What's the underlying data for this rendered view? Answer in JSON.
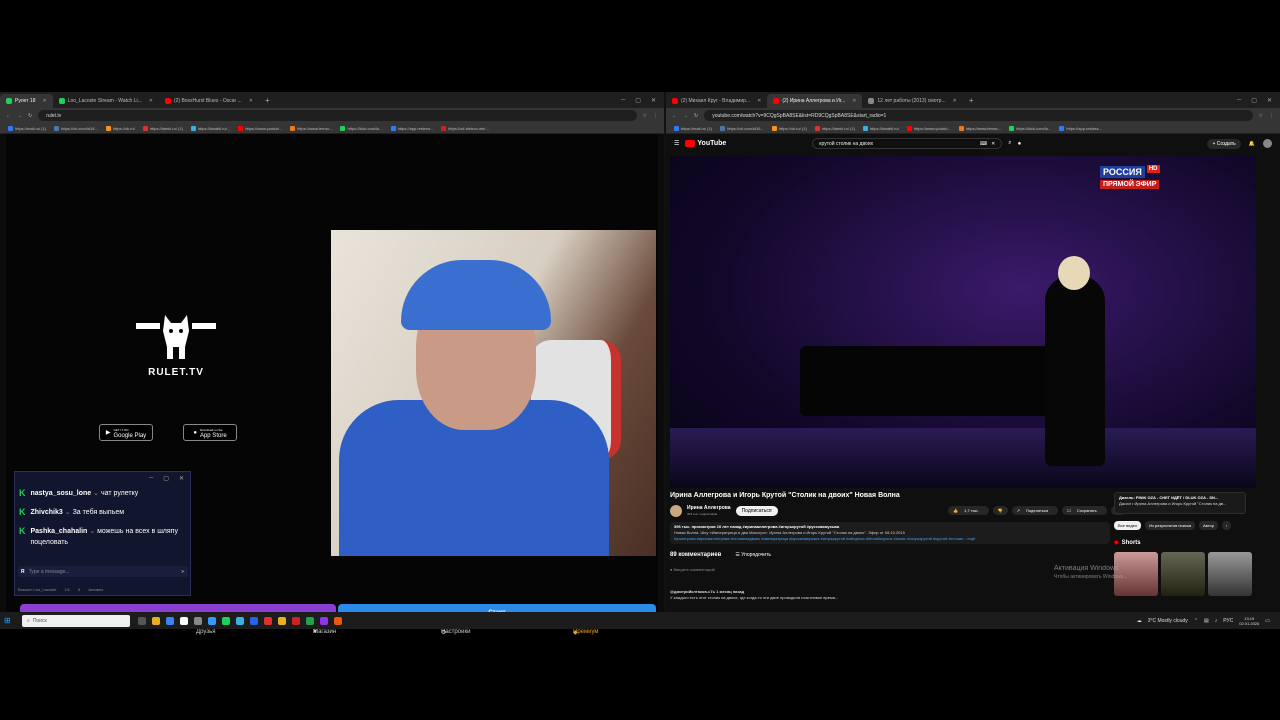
{
  "left_window": {
    "tabs": [
      {
        "label": "Рулет 18",
        "color": "#1fd15a",
        "active": true
      },
      {
        "label": "Loo_Lacoste Stream - Watch Li...",
        "color": "#1fd15a",
        "active": false
      },
      {
        "label": "(2) BossHurst Blues - Oscar ...",
        "color": "#ff0000",
        "active": false
      }
    ],
    "url": "rulet.tv",
    "bookmarks": [
      "https://mail.ru/ (1)",
      "https://vk.com/id16...",
      "https://ok.ru/",
      "https://lamki.ru/ (1)",
      "https://kwabli.ru/...",
      "https://www.youtub...",
      "https://www.terrao...",
      "https://kick.com/lo...",
      "https://app.restrea...",
      "https://zd.stetroo.me/..."
    ]
  },
  "rulet": {
    "brand": "RULET.TV",
    "google_play": "Google Play",
    "google_play_small": "GET IT ON",
    "app_store": "App Store",
    "app_store_small": "Download on the",
    "start_button": "Старт",
    "nav": {
      "friends": "Друзья",
      "shop": "Магазин",
      "settings": "Настройки",
      "premium": "Премиум"
    }
  },
  "chat": {
    "messages": [
      {
        "user": "nastya_sosu_lone",
        "text": "чат рулетку"
      },
      {
        "user": "Zhivchik3",
        "text": "За тебя выпьем"
      },
      {
        "user": "Pashka_chahalin",
        "text": "можешь на всех в шляпу поцеловать"
      }
    ],
    "input_placeholder": "Type a message...",
    "footer_channel": "Bossum Loo_Lacoste",
    "footer_count": "1/1",
    "footer_n": "5",
    "footer_status": "Активно"
  },
  "right_window": {
    "tabs": [
      {
        "label": "(2) Михаил Круг - Владимир...",
        "color": "#ff0000",
        "active": false
      },
      {
        "label": "(2) Ирина Аллегрова и Иг...",
        "color": "#ff0000",
        "active": true
      },
      {
        "label": "12 лет работы (2013) смотр...",
        "color": "#888888",
        "active": false
      }
    ],
    "url": "youtube.com/watch?v=9CQgSpBA8SE&list=RD9CQgSpBA8SE&start_radio=1",
    "bookmarks": [
      "https://mail.ru/ (1)",
      "https://vk.com/id16...",
      "https://ok.ru/ (1)",
      "https://lamki.ru/ (1)",
      "https://kwabli.ru/",
      "https://www.youtub...",
      "https://www.terrao...",
      "https://kick.com/lo...",
      "https://app.restrea..."
    ]
  },
  "youtube": {
    "logo": "YouTube",
    "search_query": "крутой столик на двоих",
    "create_label": "Создать",
    "channel_badge": "РОССИЯ",
    "channel_badge_hd": "HD",
    "live_badge": "ПРЯМОЙ ЭФИР",
    "video_title": "Ирина Аллегрова и Игорь Крутой \"Столик на двоих\" Новая Волна",
    "channel_name": "Ирина Аллегрова",
    "subscribers": "303 тыс. подписчиков",
    "subscribe_label": "Подписаться",
    "likes": "1,7 тыс.",
    "share_label": "Поделиться",
    "save_label": "Сохранить",
    "desc_stats": "396 тыс. просмотров  10 лет назад  #ирина​аллегрова #игорькрутой #русскаямузыка",
    "desc_text": "Новая Волна. Шоу «Императрица и два Маэстро». Ирина Аллегрова и Игорь Крутой \"Столик на двоих\". Эфир от 08.10.2015",
    "desc_tags": "#аллегрова #иринааллегрова #столикнадвоих #императрица #русскаямузыка #игорькрутой #allegrova #IrinaAllegrova #music #игорькрутой #крутой #столик ...ещё",
    "comments_count": "89 комментариев",
    "sort_label": "Упорядочить",
    "add_comment": "Введите комментарий",
    "comment_user": "@дмитрийклтаков-с7ь  1 месяц назад",
    "comment_text": "У каждого есть этот столик на двоих, где когда-то эти двое проводили счастливое время...",
    "promo_title": "Дизель: FINIK OZA - СНЕГ ИДЁТ / DLUK OZA - SN...",
    "promo_sub": "Джоэл • Ирина Аллегрова и Игорь Крутой \"Столик на дв...",
    "chips": [
      "Все видео",
      "Из результатов поиска",
      "Автор"
    ],
    "shorts_label": "Shorts",
    "activation_line1": "Активация Windows",
    "activation_line2": "Чтобы активировать Windows..."
  },
  "taskbar": {
    "search_placeholder": "Поиск",
    "weather": "3°C  Mostly cloudy",
    "lang": "РУС",
    "time": "13:19",
    "date": "02.01.2026"
  },
  "colors": {
    "purple_bar": "#8a3fd0",
    "blue_bar": "#2a8be8",
    "kick_green": "#1fd15a",
    "youtube_red": "#ff0000"
  }
}
